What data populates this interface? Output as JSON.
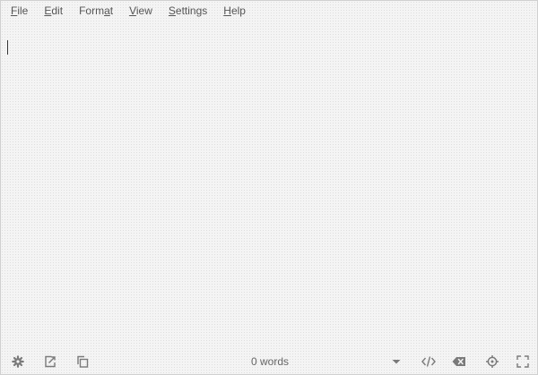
{
  "menubar": {
    "items": [
      {
        "pre": "",
        "key": "F",
        "post": "ile"
      },
      {
        "pre": "",
        "key": "E",
        "post": "dit"
      },
      {
        "pre": "Form",
        "key": "a",
        "post": "t"
      },
      {
        "pre": "",
        "key": "V",
        "post": "iew"
      },
      {
        "pre": "",
        "key": "S",
        "post": "ettings"
      },
      {
        "pre": "",
        "key": "H",
        "post": "elp"
      }
    ]
  },
  "statusbar": {
    "word_count": "0 words",
    "icons": [
      "settings-icon",
      "export-icon",
      "copy-icon",
      "dropdown-icon",
      "code-icon",
      "clear-icon",
      "target-icon",
      "fullscreen-icon"
    ]
  },
  "editor": {
    "text": ""
  }
}
